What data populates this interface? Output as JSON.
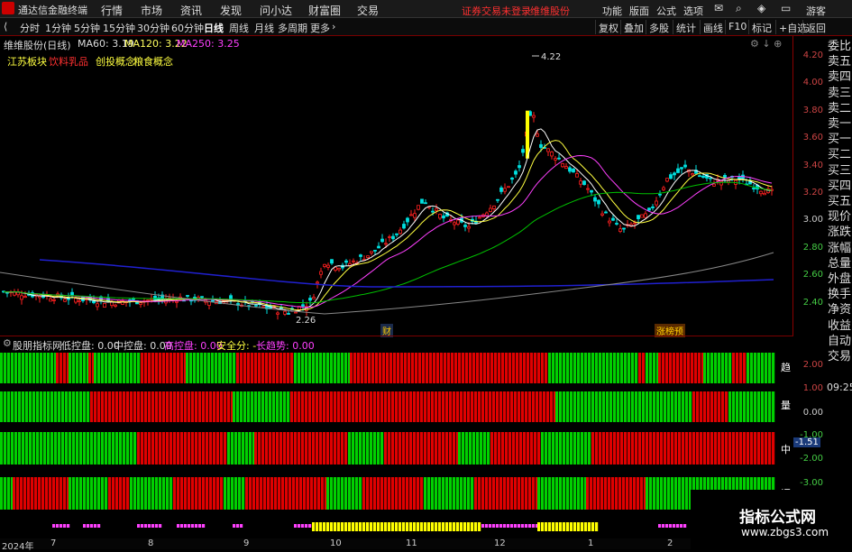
{
  "app": {
    "title": "通达信金融终端",
    "menus": [
      "行情",
      "市场",
      "资讯",
      "发现",
      "问小达",
      "财富圈",
      "交易"
    ],
    "notice": "证券交易未登录",
    "stock_tag": "维维股份",
    "right_menus": [
      "功能",
      "版面",
      "公式",
      "选项"
    ],
    "user": "游客"
  },
  "toolbar": {
    "periods": [
      "分时",
      "1分钟",
      "5分钟",
      "15分钟",
      "30分钟",
      "60分钟",
      "日线",
      "周线",
      "月线",
      "多周期",
      "更多"
    ],
    "active": "日线",
    "right_buttons": [
      "复权",
      "叠加",
      "多股",
      "统计",
      "画线",
      "F10",
      "标记",
      "+自选",
      "返回"
    ]
  },
  "chart": {
    "stock_label": "维维股份(日线)",
    "ma60": "MA60: 3.19",
    "ma120": "MA120: 3.22",
    "ma250": "MA250: 3.25",
    "concepts": [
      "江苏板块",
      "饮料乳品",
      "创投概念",
      "粮食概念"
    ],
    "high_label": "4.22",
    "low_label": "2.26",
    "marker1": "财",
    "marker2": "涨榜预",
    "yticks": [
      "4.20",
      "4.00",
      "3.80",
      "3.60",
      "3.40",
      "3.20",
      "3.00",
      "2.80",
      "2.60",
      "2.40"
    ]
  },
  "indicator": {
    "name": "股朋指标网",
    "low": "低控盘: 0.00",
    "mid": "中控盘: 0.00",
    "high": "高控盘: 0.00",
    "safe": "安全分: -",
    "trend": "长趋势: 0.00",
    "row_labels": [
      "趋",
      "量",
      "中",
      "调"
    ],
    "yticks": [
      "2.00",
      "1.00",
      "0.00",
      "-1.00",
      "-2.00",
      "-3.00"
    ],
    "current": "-1.51"
  },
  "right_panel": {
    "items": [
      "委比",
      "卖五",
      "卖四",
      "卖三",
      "卖二",
      "卖一",
      "买一",
      "买二",
      "买三",
      "买四",
      "买五",
      "现价",
      "涨跌",
      "涨幅",
      "总量",
      "外盘",
      "换手",
      "净资",
      "收益",
      "自动",
      "交易"
    ],
    "time": "09:25"
  },
  "dates": [
    "2024年",
    "7",
    "8",
    "9",
    "10",
    "11",
    "12",
    "1",
    "2"
  ],
  "watermark": {
    "title": "指标公式网",
    "url": "www.zbgs3.com"
  },
  "colors": {
    "up": "#ff2020",
    "down": "#00e0e0",
    "green": "#00d000",
    "red": "#e00000",
    "yellow": "#ffff00",
    "magenta": "#ff00ff"
  }
}
